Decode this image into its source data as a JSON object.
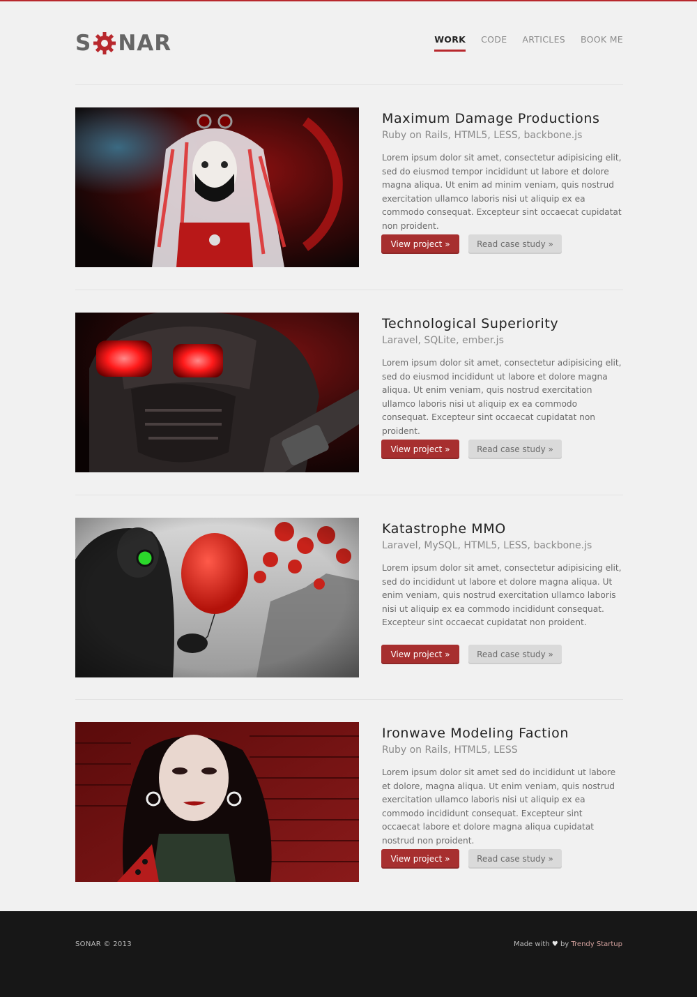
{
  "brand": {
    "logo_left": "S",
    "logo_right": "NAR",
    "accent": "#b8282d",
    "logo_icon": "gear-icon"
  },
  "nav": {
    "items": [
      {
        "label": "WORK",
        "active": true
      },
      {
        "label": "CODE",
        "active": false
      },
      {
        "label": "ARTICLES",
        "active": false
      },
      {
        "label": "BOOK ME",
        "active": false
      }
    ]
  },
  "projects": [
    {
      "title": "Maximum Damage Productions",
      "tech": "Ruby on Rails, HTML5, LESS, backbone.js",
      "description": "Lorem ipsum dolor sit amet, consectetur adipisicing elit, sed do eiusmod tempor incididunt ut labore et dolore magna aliqua. Ut enim ad minim veniam, quis nostrud exercitation ullamco laboris nisi ut aliquip ex ea commodo consequat. Excepteur sint occaecat cupidatat non proident.",
      "primary_label": "View project »",
      "secondary_label": "Read case study »"
    },
    {
      "title": "Technological Superiority",
      "tech": "Laravel, SQLite, ember.js",
      "description": "Lorem ipsum dolor sit amet, consectetur adipisicing elit, sed do eiusmod incididunt ut labore et dolore magna aliqua. Ut enim veniam, quis nostrud exercitation ullamco laboris nisi ut aliquip ex ea commodo consequat. Excepteur sint occaecat cupidatat non proident.",
      "primary_label": "View project »",
      "secondary_label": "Read case study »"
    },
    {
      "title": "Katastrophe MMO",
      "tech": "Laravel, MySQL, HTML5, LESS, backbone.js",
      "description": "Lorem ipsum dolor sit amet, consectetur adipisicing elit, sed do incididunt ut labore et dolore magna aliqua. Ut enim veniam, quis nostrud exercitation ullamco laboris nisi ut aliquip ex ea commodo incididunt consequat. Excepteur sint occaecat cupidatat non proident.",
      "primary_label": "View project »",
      "secondary_label": "Read case study »"
    },
    {
      "title": "Ironwave Modeling Faction",
      "tech": "Ruby on Rails, HTML5, LESS",
      "description": "Lorem ipsum dolor sit amet sed do incididunt ut labore et dolore, magna aliqua. Ut enim veniam, quis nostrud exercitation ullamco laboris nisi ut aliquip ex ea commodo incididunt consequat. Excepteur sint occaecat labore et dolore magna aliqua cupidatat nostrud non proident.",
      "primary_label": "View project »",
      "secondary_label": "Read case study »"
    }
  ],
  "footer": {
    "copyright": "SONAR © 2013",
    "made_prefix": "Made with",
    "heart": "♥",
    "made_by": "by",
    "credit_link": "Trendy Startup"
  }
}
